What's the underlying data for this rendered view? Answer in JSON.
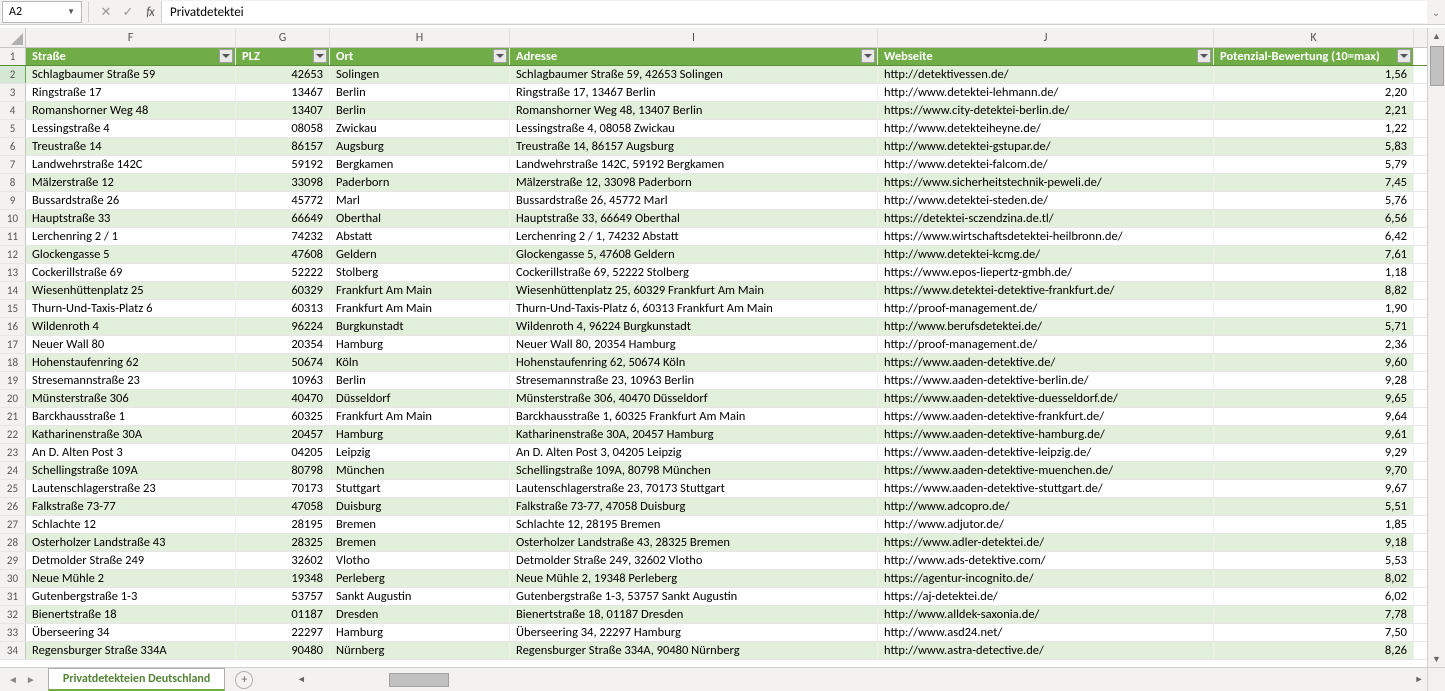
{
  "name_box": "A2",
  "formula_value": "Privatdetektei",
  "columns": {
    "letters": [
      "F",
      "G",
      "H",
      "I",
      "J",
      "K"
    ],
    "headers": [
      "Straße",
      "PLZ",
      "Ort",
      "Adresse",
      "Webseite",
      "Potenzial-Bewertung (10=max)"
    ]
  },
  "sheet_tab": "Privatdetekteien Deutschland",
  "rows": [
    {
      "n": 2,
      "F": "Schlagbaumer Straße 59",
      "G": "42653",
      "H": "Solingen",
      "I": "Schlagbaumer Straße 59, 42653 Solingen",
      "J": "http://detektivessen.de/",
      "K": "1,56"
    },
    {
      "n": 3,
      "F": "Ringstraße 17",
      "G": "13467",
      "H": "Berlin",
      "I": "Ringstraße 17, 13467 Berlin",
      "J": "http://www.detektei-lehmann.de/",
      "K": "2,20"
    },
    {
      "n": 4,
      "F": "Romanshorner Weg 48",
      "G": "13407",
      "H": "Berlin",
      "I": "Romanshorner Weg 48, 13407 Berlin",
      "J": "https://www.city-detektei-berlin.de/",
      "K": "2,21"
    },
    {
      "n": 5,
      "F": "Lessingstraße 4",
      "G": "08058",
      "H": "Zwickau",
      "I": "Lessingstraße 4, 08058 Zwickau",
      "J": "http://www.detekteiheyne.de/",
      "K": "1,22"
    },
    {
      "n": 6,
      "F": "Treustraße 14",
      "G": "86157",
      "H": "Augsburg",
      "I": "Treustraße 14, 86157 Augsburg",
      "J": "http://www.detektei-gstupar.de/",
      "K": "5,83"
    },
    {
      "n": 7,
      "F": "Landwehrstraße 142C",
      "G": "59192",
      "H": "Bergkamen",
      "I": "Landwehrstraße 142C, 59192 Bergkamen",
      "J": "http://www.detektei-falcom.de/",
      "K": "5,79"
    },
    {
      "n": 8,
      "F": "Mälzerstraße 12",
      "G": "33098",
      "H": "Paderborn",
      "I": "Mälzerstraße 12, 33098 Paderborn",
      "J": "https://www.sicherheitstechnik-peweli.de/",
      "K": "7,45"
    },
    {
      "n": 9,
      "F": "Bussardstraße 26",
      "G": "45772",
      "H": "Marl",
      "I": "Bussardstraße 26, 45772 Marl",
      "J": "http://www.detektei-steden.de/",
      "K": "5,76"
    },
    {
      "n": 10,
      "F": "Hauptstraße 33",
      "G": "66649",
      "H": "Oberthal",
      "I": "Hauptstraße 33, 66649 Oberthal",
      "J": "https://detektei-sczendzina.de.tl/",
      "K": "6,56"
    },
    {
      "n": 11,
      "F": "Lerchenring 2 / 1",
      "G": "74232",
      "H": "Abstatt",
      "I": "Lerchenring 2 / 1, 74232 Abstatt",
      "J": "https://www.wirtschaftsdetektei-heilbronn.de/",
      "K": "6,42"
    },
    {
      "n": 12,
      "F": "Glockengasse 5",
      "G": "47608",
      "H": "Geldern",
      "I": "Glockengasse 5, 47608 Geldern",
      "J": "http://www.detektei-kcmg.de/",
      "K": "7,61"
    },
    {
      "n": 13,
      "F": "Cockerillstraße 69",
      "G": "52222",
      "H": "Stolberg",
      "I": "Cockerillstraße 69, 52222 Stolberg",
      "J": "https://www.epos-liepertz-gmbh.de/",
      "K": "1,18"
    },
    {
      "n": 14,
      "F": "Wiesenhüttenplatz 25",
      "G": "60329",
      "H": "Frankfurt Am Main",
      "I": "Wiesenhüttenplatz 25, 60329 Frankfurt Am Main",
      "J": "https://www.detektei-detektive-frankfurt.de/",
      "K": "8,82"
    },
    {
      "n": 15,
      "F": "Thurn-Und-Taxis-Platz 6",
      "G": "60313",
      "H": "Frankfurt Am Main",
      "I": "Thurn-Und-Taxis-Platz 6, 60313 Frankfurt Am Main",
      "J": "http://proof-management.de/",
      "K": "1,90"
    },
    {
      "n": 16,
      "F": "Wildenroth 4",
      "G": "96224",
      "H": "Burgkunstadt",
      "I": "Wildenroth 4, 96224 Burgkunstadt",
      "J": "http://www.berufsdetektei.de/",
      "K": "5,71"
    },
    {
      "n": 17,
      "F": "Neuer Wall 80",
      "G": "20354",
      "H": "Hamburg",
      "I": "Neuer Wall 80, 20354 Hamburg",
      "J": "http://proof-management.de/",
      "K": "2,36"
    },
    {
      "n": 18,
      "F": "Hohenstaufenring 62",
      "G": "50674",
      "H": "Köln",
      "I": "Hohenstaufenring 62, 50674 Köln",
      "J": "https://www.aaden-detektive.de/",
      "K": "9,60"
    },
    {
      "n": 19,
      "F": "Stresemannstraße 23",
      "G": "10963",
      "H": "Berlin",
      "I": "Stresemannstraße 23, 10963 Berlin",
      "J": "https://www.aaden-detektive-berlin.de/",
      "K": "9,28"
    },
    {
      "n": 20,
      "F": "Münsterstraße 306",
      "G": "40470",
      "H": "Düsseldorf",
      "I": "Münsterstraße 306, 40470 Düsseldorf",
      "J": "https://www.aaden-detektive-duesseldorf.de/",
      "K": "9,65"
    },
    {
      "n": 21,
      "F": "Barckhausstraße 1",
      "G": "60325",
      "H": "Frankfurt Am Main",
      "I": "Barckhausstraße 1, 60325 Frankfurt Am Main",
      "J": "https://www.aaden-detektive-frankfurt.de/",
      "K": "9,64"
    },
    {
      "n": 22,
      "F": "Katharinenstraße 30A",
      "G": "20457",
      "H": "Hamburg",
      "I": "Katharinenstraße 30A, 20457 Hamburg",
      "J": "https://www.aaden-detektive-hamburg.de/",
      "K": "9,61"
    },
    {
      "n": 23,
      "F": "An D. Alten Post 3",
      "G": "04205",
      "H": "Leipzig",
      "I": "An D. Alten Post 3, 04205 Leipzig",
      "J": "https://www.aaden-detektive-leipzig.de/",
      "K": "9,29"
    },
    {
      "n": 24,
      "F": "Schellingstraße 109A",
      "G": "80798",
      "H": "München",
      "I": "Schellingstraße 109A, 80798 München",
      "J": "https://www.aaden-detektive-muenchen.de/",
      "K": "9,70"
    },
    {
      "n": 25,
      "F": "Lautenschlagerstraße 23",
      "G": "70173",
      "H": "Stuttgart",
      "I": "Lautenschlagerstraße 23, 70173 Stuttgart",
      "J": "https://www.aaden-detektive-stuttgart.de/",
      "K": "9,67"
    },
    {
      "n": 26,
      "F": "Falkstraße 73-77",
      "G": "47058",
      "H": "Duisburg",
      "I": "Falkstraße 73-77, 47058 Duisburg",
      "J": "http://www.adcopro.de/",
      "K": "5,51"
    },
    {
      "n": 27,
      "F": "Schlachte 12",
      "G": "28195",
      "H": "Bremen",
      "I": "Schlachte 12, 28195 Bremen",
      "J": "http://www.adjutor.de/",
      "K": "1,85"
    },
    {
      "n": 28,
      "F": "Osterholzer Landstraße 43",
      "G": "28325",
      "H": "Bremen",
      "I": "Osterholzer Landstraße 43, 28325 Bremen",
      "J": "https://www.adler-detektei.de/",
      "K": "9,18"
    },
    {
      "n": 29,
      "F": "Detmolder Straße 249",
      "G": "32602",
      "H": "Vlotho",
      "I": "Detmolder Straße 249, 32602 Vlotho",
      "J": "http://www.ads-detektive.com/",
      "K": "5,53"
    },
    {
      "n": 30,
      "F": "Neue Mühle 2",
      "G": "19348",
      "H": "Perleberg",
      "I": "Neue Mühle 2, 19348 Perleberg",
      "J": "https://agentur-incognito.de/",
      "K": "8,02"
    },
    {
      "n": 31,
      "F": "Gutenbergstraße 1-3",
      "G": "53757",
      "H": "Sankt Augustin",
      "I": "Gutenbergstraße 1-3, 53757 Sankt Augustin",
      "J": "https://aj-detektei.de/",
      "K": "6,02"
    },
    {
      "n": 32,
      "F": "Bienertstraße 18",
      "G": "01187",
      "H": "Dresden",
      "I": "Bienertstraße 18, 01187 Dresden",
      "J": "http://www.alldek-saxonia.de/",
      "K": "7,78"
    },
    {
      "n": 33,
      "F": "Überseering 34",
      "G": "22297",
      "H": "Hamburg",
      "I": "Überseering 34, 22297 Hamburg",
      "J": "http://www.asd24.net/",
      "K": "7,50"
    },
    {
      "n": 34,
      "F": "Regensburger Straße 334A",
      "G": "90480",
      "H": "Nürnberg",
      "I": "Regensburger Straße 334A, 90480 Nürnberg",
      "J": "http://www.astra-detective.de/",
      "K": "8,26"
    }
  ]
}
